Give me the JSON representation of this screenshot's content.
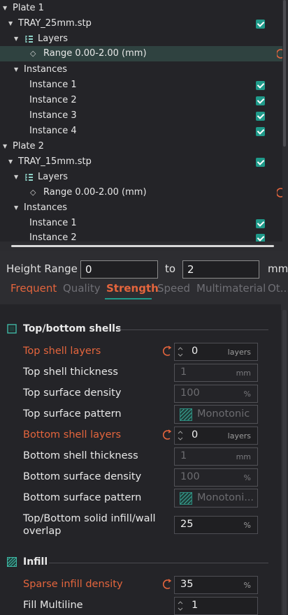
{
  "tree": {
    "plates": [
      {
        "label": "Plate 1",
        "object": "TRAY_25mm.stp",
        "layers_label": "Layers",
        "range_label": "Range 0.00-2.00 (mm)",
        "instances_label": "Instances",
        "instances": [
          "Instance 1",
          "Instance 2",
          "Instance 3",
          "Instance 4"
        ]
      },
      {
        "label": "Plate 2",
        "object": "TRAY_15mm.stp",
        "layers_label": "Layers",
        "range_label": "Range 0.00-2.00 (mm)",
        "instances_label": "Instances",
        "instances": [
          "Instance 1",
          "Instance 2"
        ]
      }
    ]
  },
  "height_range": {
    "label": "Height Range",
    "from": "0",
    "to_label": "to",
    "to": "2",
    "unit": "mm"
  },
  "tabs": [
    "Frequent",
    "Quality",
    "Strength",
    "Speed",
    "Multimaterial",
    "Ot..."
  ],
  "active_tab": "Strength",
  "sections": {
    "top_bottom": {
      "title": "Top/bottom shells",
      "options": [
        {
          "label": "Top shell layers",
          "value": "0",
          "unit": "layers"
        },
        {
          "label": "Top shell thickness",
          "value": "1",
          "unit": "mm"
        },
        {
          "label": "Top surface density",
          "value": "100",
          "unit": "%"
        },
        {
          "label": "Top surface pattern",
          "value": "Monotonic"
        },
        {
          "label": "Bottom shell layers",
          "value": "0",
          "unit": "layers"
        },
        {
          "label": "Bottom shell thickness",
          "value": "1",
          "unit": "mm"
        },
        {
          "label": "Bottom surface density",
          "value": "100",
          "unit": "%"
        },
        {
          "label": "Bottom surface pattern",
          "value": "Monotoni..."
        },
        {
          "label_line1": "Top/Bottom solid infill/wall",
          "label_line2": "overlap",
          "value": "25",
          "unit": "%"
        }
      ]
    },
    "infill": {
      "title": "Infill",
      "options": [
        {
          "label": "Sparse infill density",
          "value": "35",
          "unit": "%"
        },
        {
          "label": "Fill Multiline",
          "value": "1"
        }
      ]
    }
  },
  "colors": {
    "accent": "#1f9a8a",
    "modified": "#e4653d",
    "panel_bg": "#242428",
    "window_bg": "#2d2d31"
  }
}
